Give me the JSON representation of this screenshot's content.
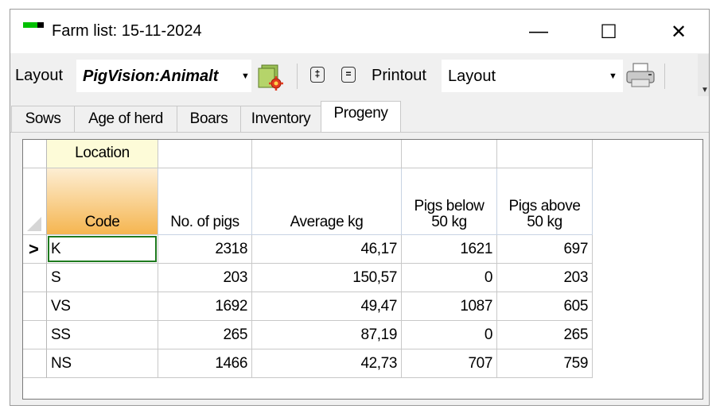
{
  "window": {
    "title": "Farm list: 15-11-2024",
    "minimize_glyph": "—",
    "maximize_glyph": "☐",
    "close_glyph": "✕"
  },
  "toolbar": {
    "layout_label": "Layout",
    "layout_value": "PigVision:Animalt",
    "expand_glyph": "‡",
    "collapse_glyph": "=",
    "printout_label": "Printout",
    "printout_value": "Layout",
    "dropdown_glyph": "▼",
    "grip_glyph": "▼",
    "icons": [
      "settings-report-icon",
      "expand-rows-icon",
      "collapse-rows-icon",
      "printer-icon"
    ]
  },
  "tabs": [
    {
      "label": "Sows",
      "active": false
    },
    {
      "label": "Age of herd",
      "active": false
    },
    {
      "label": "Boars",
      "active": false
    },
    {
      "label": "Inventory",
      "active": false
    },
    {
      "label": "Progeny",
      "active": true
    }
  ],
  "grid": {
    "band_header": "Location",
    "columns": [
      {
        "line1": "",
        "line2": "Code"
      },
      {
        "line1": "",
        "line2": "No. of pigs"
      },
      {
        "line1": "",
        "line2": "Average kg"
      },
      {
        "line1": "Pigs below",
        "line2": "50 kg"
      },
      {
        "line1": "Pigs above",
        "line2": "50 kg"
      }
    ],
    "current_row_marker": ">",
    "rows": [
      [
        "K",
        "2318",
        "46,17",
        "1621",
        "697"
      ],
      [
        "S",
        "203",
        "150,57",
        "0",
        "203"
      ],
      [
        "VS",
        "1692",
        "49,47",
        "1087",
        "605"
      ],
      [
        "SS",
        "265",
        "87,19",
        "0",
        "265"
      ],
      [
        "NS",
        "1466",
        "42,73",
        "707",
        "759"
      ]
    ],
    "selected_row": 0,
    "colors": {
      "code_header_top": "#fdeed3",
      "code_header_bottom": "#f5b550",
      "band_header": "#fdfbd8",
      "selection_border": "#1e7a1e"
    }
  }
}
